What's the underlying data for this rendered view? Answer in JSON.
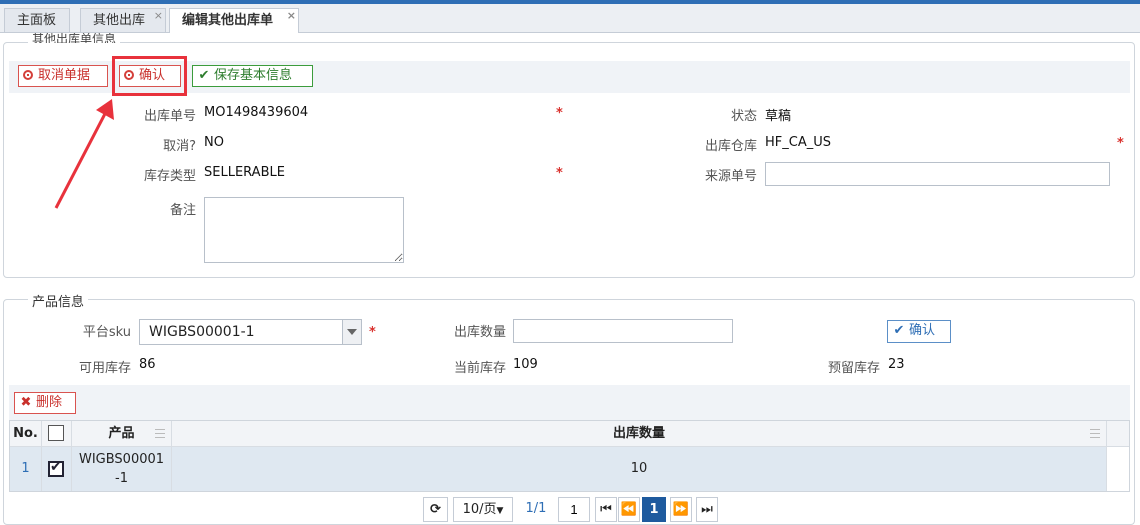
{
  "tabs": [
    {
      "label": "主面板"
    },
    {
      "label": "其他出库",
      "close": "×"
    },
    {
      "label": "编辑其他出库单",
      "close": "×"
    }
  ],
  "order_section": {
    "legend": "其他出库单信息",
    "cancel_button": "取消单据",
    "confirm_button": "确认",
    "save_button": "保存基本信息",
    "fields": {
      "order_no_label": "出库单号",
      "order_no": "MO1498439604",
      "status_label": "状态",
      "status": "草稿",
      "cancelled_label": "取消?",
      "cancelled": "NO",
      "warehouse_label": "出库仓库",
      "warehouse": "HF_CA_US",
      "stock_type_label": "库存类型",
      "stock_type": "SELLERABLE",
      "source_no_label": "来源单号",
      "source_no": "",
      "remark_label": "备注",
      "remark": ""
    },
    "required_mark": "*"
  },
  "product_section": {
    "legend": "产品信息",
    "sku_label": "平台sku",
    "sku_value": "WIGBS00001-1",
    "qty_label": "出库数量",
    "qty_value": "",
    "confirm_button": "确认",
    "available_label": "可用库存",
    "available": "86",
    "current_label": "当前库存",
    "current": "109",
    "reserved_label": "预留库存",
    "reserved": "23",
    "delete_button": "删除"
  },
  "grid": {
    "headers": {
      "no": "No.",
      "product": "产品",
      "qty": "出库数量"
    },
    "rows": [
      {
        "no": "1",
        "product_line1": "WIGBS00001",
        "product_line2": "-1",
        "qty": "10",
        "checked": true
      }
    ]
  },
  "pager": {
    "page_size": "10/页",
    "page_info": "1/1",
    "page_input": "1",
    "current_page": "1"
  },
  "colors": {
    "accent": "#2e6eb5",
    "danger": "#d9534f",
    "success": "#3c9c3c",
    "annotation": "#e8323c"
  }
}
